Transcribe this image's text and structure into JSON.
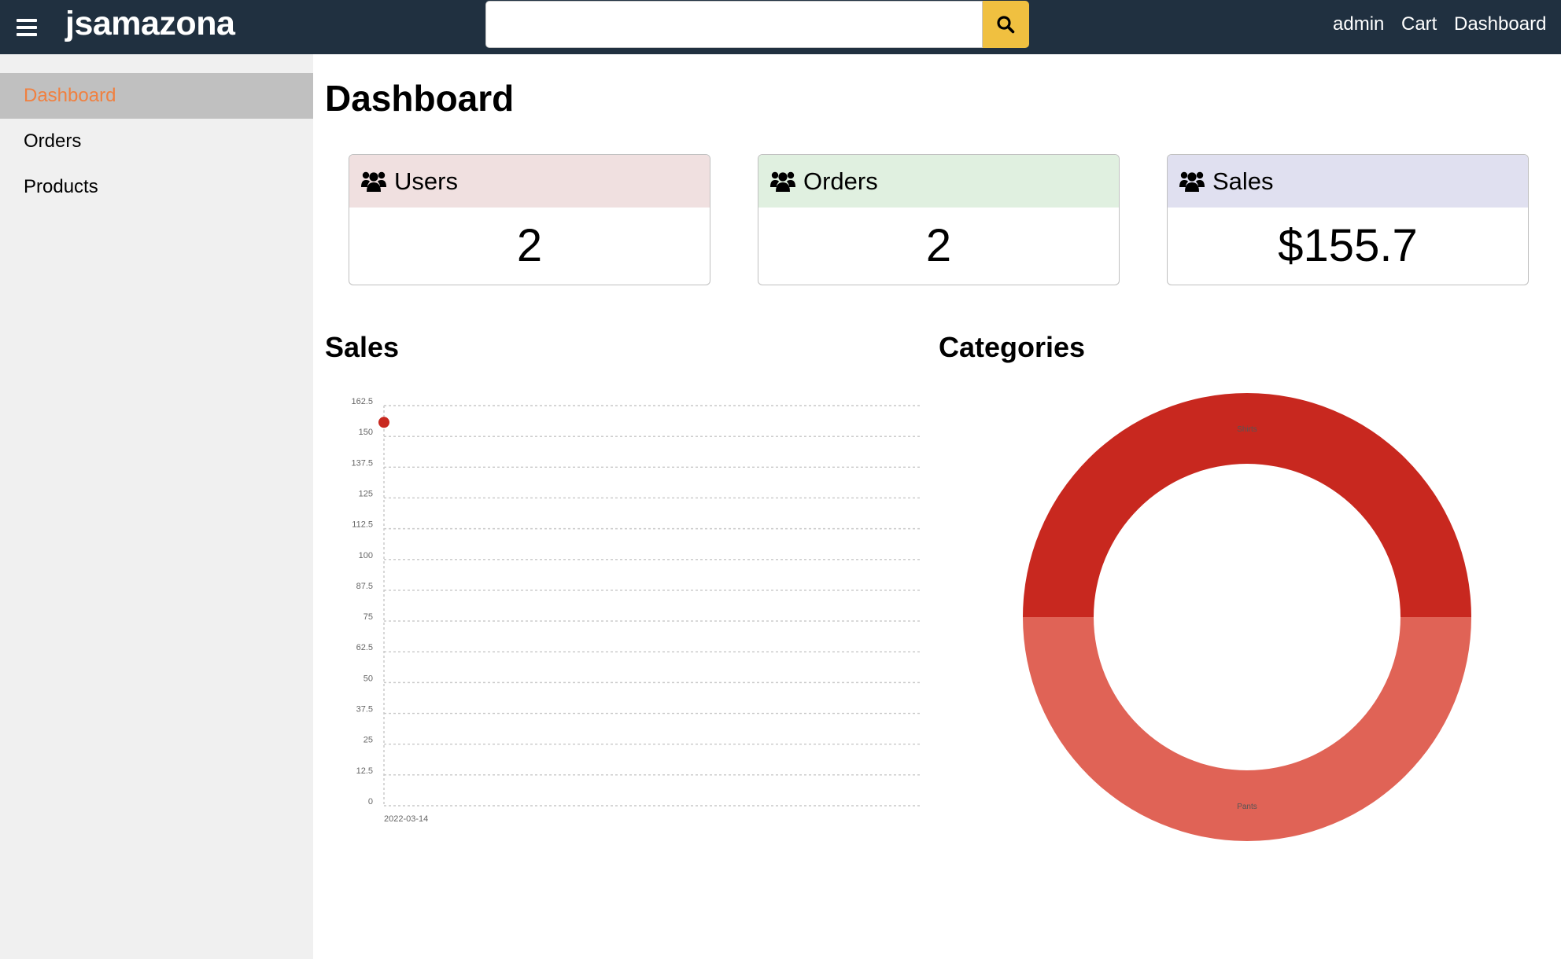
{
  "header": {
    "brand": "jsamazona",
    "search": {
      "value": "",
      "placeholder": ""
    },
    "links": {
      "admin": "admin",
      "cart": "Cart",
      "dashboard": "Dashboard"
    },
    "icons": {
      "menu": "hamburger-menu-icon",
      "search": "magnifier-icon"
    },
    "colors": {
      "bar": "#203040",
      "search_button": "#f0c040"
    }
  },
  "sidebar": {
    "items": [
      {
        "label": "Dashboard",
        "active": true
      },
      {
        "label": "Orders",
        "active": false
      },
      {
        "label": "Products",
        "active": false
      }
    ],
    "colors": {
      "active_text": "#f08040",
      "active_bg": "#c0c0c0"
    }
  },
  "main": {
    "title": "Dashboard",
    "cards": [
      {
        "label": "Users",
        "value": "2",
        "icon": "users-icon"
      },
      {
        "label": "Orders",
        "value": "2",
        "icon": "users-icon"
      },
      {
        "label": "Sales",
        "value": "$155.7",
        "icon": "users-icon"
      }
    ],
    "sales_title": "Sales",
    "categories_title": "Categories"
  },
  "chart_data": [
    {
      "type": "line",
      "x": [
        "2022-03-14"
      ],
      "series": [
        {
          "values": [
            155.7
          ]
        }
      ],
      "title": "",
      "xlabel": "",
      "ylabel": "",
      "ylim": [
        0,
        162.5
      ],
      "yticks": [
        "0",
        "12.5",
        "25",
        "37.5",
        "50",
        "62.5",
        "75",
        "87.5",
        "100",
        "112.5",
        "125",
        "137.5",
        "150",
        "162.5"
      ],
      "grid": true,
      "color": "#c8281f"
    },
    {
      "type": "pie",
      "donut": true,
      "categories": [
        "Shirts",
        "Pants"
      ],
      "values": [
        1,
        1
      ],
      "colors": [
        "#c8281f",
        "#e06356"
      ]
    }
  ]
}
